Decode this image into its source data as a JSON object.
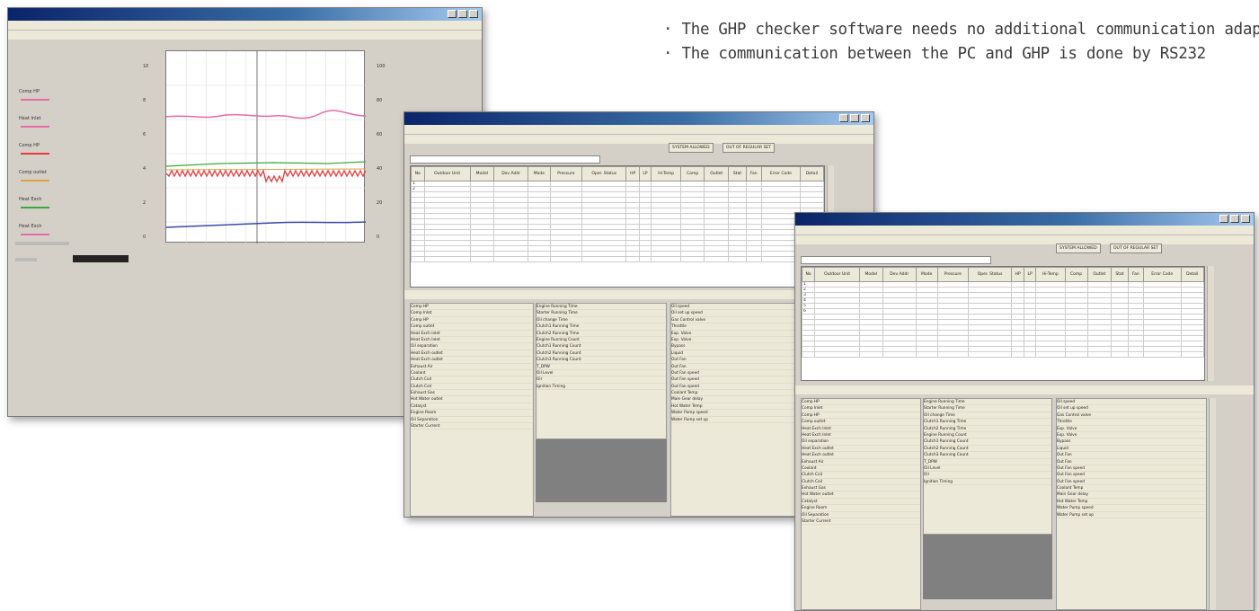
{
  "bullets": [
    "· The GHP checker software needs no additional communication adaptor",
    "· The communication between the PC and GHP is done by RS232"
  ],
  "colors": {
    "title_bar": "#0a246a",
    "pink": "#e86aa6",
    "red": "#e63a3a",
    "green": "#3aa83a",
    "blue": "#3a4aa8",
    "panel": "#ece9d8"
  },
  "window1": {
    "legend": [
      "Comp HP",
      "Heat Inlet",
      "Comp HP",
      "Comp outlet",
      "Heat Exch",
      "Heat Exch"
    ],
    "left_ticks": [
      "10",
      "8",
      "6",
      "4",
      "2",
      "0"
    ],
    "right_ticks": [
      "100",
      "80",
      "60",
      "40",
      "20",
      "0"
    ]
  },
  "window2": {
    "tabs": [
      "SYSTEM ALLOWED",
      "OUT OF REGULAR SET"
    ],
    "headers": [
      "No",
      "Outdoor Unit",
      "Model",
      "Dev Addr",
      "Mode",
      "Pressure",
      "Oper. Status",
      "HP",
      "LP",
      "Hi-Temp",
      "Comp",
      "Outlet",
      "Stat",
      "Fan",
      "Error Code",
      "Detail"
    ],
    "rows": [
      [
        "1",
        "",
        "",
        "",
        "",
        "",
        "",
        "",
        "",
        "",
        "",
        "",
        "",
        "",
        "",
        ""
      ],
      [
        "2",
        "",
        "",
        "",
        "",
        "",
        "",
        "",
        "",
        "",
        "",
        "",
        "",
        "",
        "",
        ""
      ]
    ],
    "params_col1": [
      "Comp HP",
      "Comp Inlet",
      "Comp HP",
      "Comp outlet",
      "Heat Exch Inlet",
      "Heat Exch Inlet",
      "Oil separation",
      "Heat Exch outlet",
      "Heat Exch outlet",
      "Exhaust Air",
      "Coolant",
      "Clutch Coil",
      "Clutch Coil",
      "Exhaust Gas",
      "Hot Water outlet",
      "Catalyst",
      "Engine Room",
      "Oil Separation",
      "Starter Current"
    ],
    "params_col2": [
      "Engine Running Time",
      "Starter Running Time",
      "Oil change Time",
      "Clutch1 Running Time",
      "Clutch2 Running Time",
      "Engine Running Count",
      "Clutch1 Running Count",
      "Clutch2 Running Count",
      "Clutch3 Running Count",
      "T_DPW",
      "Oil Level",
      "Oil",
      "Ignition Timing"
    ],
    "params_col3": [
      "Oil speed",
      "Oil set up speed",
      "Gas Control valve",
      "Throttle",
      "Exp. Valve",
      "Exp. Valve",
      "Bypass",
      "Liquid",
      "Out Fan",
      "Out Fan",
      "Out Fan speed",
      "Out Fan speed",
      "Out Fan speed",
      "Coolant Temp",
      "Main Gear delay",
      "Hot Water Temp",
      "Water Pump speed",
      "Water Pump set up"
    ]
  },
  "window3": {
    "tabs": [
      "SYSTEM ALLOWED",
      "OUT OF REGULAR SET"
    ],
    "headers": [
      "No",
      "Outdoor Unit",
      "Model",
      "Dev Addr",
      "Mode",
      "Pressure",
      "Oper. Status",
      "HP",
      "LP",
      "Hi-Temp",
      "Comp",
      "Outlet",
      "Stat",
      "Fan",
      "Error Code",
      "Detail"
    ],
    "rows": [
      [
        "1",
        "",
        "",
        "",
        "",
        "",
        "",
        "",
        "",
        "",
        "",
        "",
        "",
        "",
        "",
        ""
      ],
      [
        "2",
        "",
        "",
        "",
        "",
        "",
        "",
        "",
        "",
        "",
        "",
        "",
        "",
        "",
        "",
        ""
      ],
      [
        "3",
        "",
        "",
        "",
        "",
        "",
        "",
        "",
        "",
        "",
        "",
        "",
        "",
        "",
        "",
        ""
      ],
      [
        "4",
        "",
        "",
        "",
        "",
        "",
        "",
        "",
        "",
        "",
        "",
        "",
        "",
        "",
        "",
        ""
      ],
      [
        "5",
        "",
        "",
        "",
        "",
        "",
        "",
        "",
        "",
        "",
        "",
        "",
        "",
        "",
        "",
        ""
      ],
      [
        "6",
        "",
        "",
        "",
        "",
        "",
        "",
        "",
        "",
        "",
        "",
        "",
        "",
        "",
        "",
        ""
      ]
    ],
    "params_col1": [
      "Comp HP",
      "Comp Inlet",
      "Comp HP",
      "Comp outlet",
      "Heat Exch Inlet",
      "Heat Exch Inlet",
      "Oil separation",
      "Heat Exch outlet",
      "Heat Exch outlet",
      "Exhaust Air",
      "Coolant",
      "Clutch Coil",
      "Clutch Coil",
      "Exhaust Gas",
      "Hot Water outlet",
      "Catalyst",
      "Engine Room",
      "Oil Separation",
      "Starter Current"
    ],
    "params_col2": [
      "Engine Running Time",
      "Starter Running Time",
      "Oil change Time",
      "Clutch1 Running Time",
      "Clutch2 Running Time",
      "Engine Running Count",
      "Clutch1 Running Count",
      "Clutch2 Running Count",
      "Clutch3 Running Count",
      "T_DPW",
      "Oil Level",
      "Oil",
      "Ignition Timing"
    ],
    "params_col3": [
      "Oil speed",
      "Oil set up speed",
      "Gas Control valve",
      "Throttle",
      "Exp. Valve",
      "Exp. Valve",
      "Bypass",
      "Liquid",
      "Out Fan",
      "Out Fan",
      "Out Fan speed",
      "Out Fan speed",
      "Out Fan speed",
      "Coolant Temp",
      "Main Gear delay",
      "Hot Water Temp",
      "Water Pump speed",
      "Water Pump set up"
    ]
  }
}
